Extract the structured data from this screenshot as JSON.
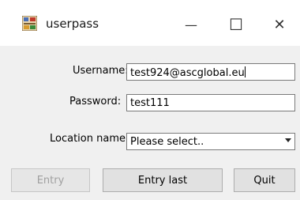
{
  "window": {
    "title": "userpass",
    "minimize_glyph": "—",
    "maximize_glyph": "☐",
    "close_glyph": "✕"
  },
  "form": {
    "username_label": "Username:",
    "username_value": "test924@ascglobal.eu",
    "password_label": "Password:",
    "password_value": "test111",
    "location_label": "Location name",
    "location_value": "Please select.."
  },
  "buttons": {
    "entry": "Entry",
    "entry_last": "Entry last",
    "quit": "Quit"
  },
  "colors": {
    "client_bg": "#f0f0f0",
    "disabled_text": "#a0a0a0"
  }
}
